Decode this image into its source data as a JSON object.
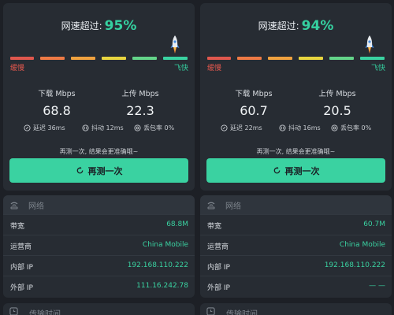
{
  "colors": {
    "accent": "#3ad2a1",
    "slow": "#e0574d",
    "card": "#272c33"
  },
  "scale_colors": [
    "#e0574d",
    "#ee7a45",
    "#f0a23f",
    "#e8d53f",
    "#b7d94a",
    "#63d489",
    "#3ad2a1"
  ],
  "panels": [
    {
      "headline_label": "网速超过:",
      "percent": "95%",
      "slow_label": "缓慢",
      "fast_label": "飞快",
      "download_label": "下载 Mbps",
      "download_value": "68.8",
      "upload_label": "上传 Mbps",
      "upload_value": "22.3",
      "latency": "延迟 36ms",
      "jitter": "抖动 12ms",
      "loss": "丢包率 0%",
      "hint": "再测一次, 结果会更准确哦~",
      "retest_label": "再测一次",
      "network_title": "网络",
      "network_rows": [
        {
          "key": "带宽",
          "value": "68.8M"
        },
        {
          "key": "运营商",
          "value": "China Mobile"
        },
        {
          "key": "内部 IP",
          "value": "192.168.110.222"
        },
        {
          "key": "外部 IP",
          "value": "111.16.242.78"
        }
      ],
      "next_title": "传输时间"
    },
    {
      "headline_label": "网速超过:",
      "percent": "94%",
      "slow_label": "缓慢",
      "fast_label": "飞快",
      "download_label": "下载 Mbps",
      "download_value": "60.7",
      "upload_label": "上传 Mbps",
      "upload_value": "20.5",
      "latency": "延迟 22ms",
      "jitter": "抖动 16ms",
      "loss": "丢包率 0%",
      "hint": "再测一次, 结果会更准确哦~",
      "retest_label": "再测一次",
      "network_title": "网络",
      "network_rows": [
        {
          "key": "带宽",
          "value": "60.7M"
        },
        {
          "key": "运营商",
          "value": "China Mobile"
        },
        {
          "key": "内部 IP",
          "value": "192.168.110.222"
        },
        {
          "key": "外部 IP",
          "value": "— —"
        }
      ],
      "next_title": "传输时间"
    }
  ]
}
